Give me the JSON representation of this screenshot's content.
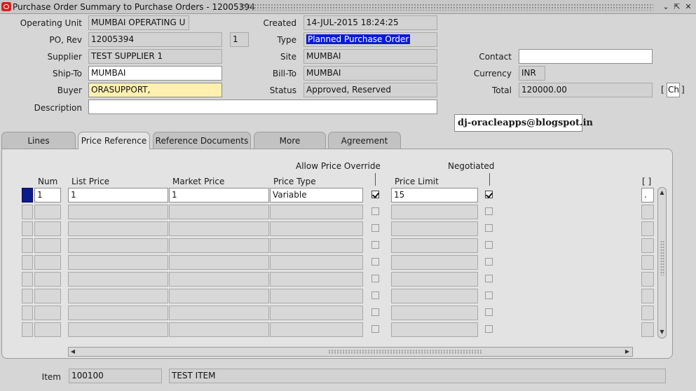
{
  "window": {
    "title": "Purchase Order Summary to Purchase Orders - 12005394",
    "buttons": {
      "minimize": "⌄",
      "restore": "⇱",
      "close": "✕"
    }
  },
  "header": {
    "operating_unit": {
      "label": "Operating Unit",
      "value": "MUMBAI OPERATING U"
    },
    "po_rev": {
      "label": "PO, Rev",
      "po": "12005394",
      "rev": "1"
    },
    "supplier": {
      "label": "Supplier",
      "value": "TEST SUPPLIER 1"
    },
    "ship_to": {
      "label": "Ship-To",
      "value": "MUMBAI"
    },
    "buyer": {
      "label": "Buyer",
      "value": "ORASUPPORT,"
    },
    "description": {
      "label": "Description",
      "value": ""
    },
    "created": {
      "label": "Created",
      "value": "14-JUL-2015 18:24:25"
    },
    "type": {
      "label": "Type",
      "value": "Planned Purchase Order"
    },
    "site": {
      "label": "Site",
      "value": "MUMBAI"
    },
    "bill_to": {
      "label": "Bill-To",
      "value": "MUMBAI"
    },
    "status": {
      "label": "Status",
      "value": "Approved, Reserved"
    },
    "contact": {
      "label": "Contact",
      "value": ""
    },
    "currency": {
      "label": "Currency",
      "value": "INR"
    },
    "total": {
      "label": "Total",
      "value": "120000.00",
      "bracket_left": "[",
      "bracket_right": "]",
      "flex_value": "Ch"
    }
  },
  "watermark": "dj-oracleapps@blogspot.in",
  "tabs": [
    {
      "label": "Lines",
      "active": false
    },
    {
      "label": "Price Reference",
      "active": true
    },
    {
      "label": "Reference Documents",
      "active": false
    },
    {
      "label": "More",
      "active": false
    },
    {
      "label": "Agreement",
      "active": false
    }
  ],
  "table": {
    "headers": {
      "num": "Num",
      "list_price": "List Price",
      "market_price": "Market Price",
      "price_type": "Price Type",
      "allow_override": "Allow Price Override",
      "price_limit": "Price Limit",
      "negotiated": "Negotiated",
      "flex": "[ ]"
    },
    "rows": [
      {
        "num": "1",
        "list_price": "1",
        "market_price": "1",
        "price_type": "Variable",
        "allow_override": true,
        "price_limit": "15",
        "negotiated": true,
        "flex": "."
      },
      {
        "num": "",
        "list_price": "",
        "market_price": "",
        "price_type": "",
        "allow_override": false,
        "price_limit": "",
        "negotiated": false,
        "flex": ""
      },
      {
        "num": "",
        "list_price": "",
        "market_price": "",
        "price_type": "",
        "allow_override": false,
        "price_limit": "",
        "negotiated": false,
        "flex": ""
      },
      {
        "num": "",
        "list_price": "",
        "market_price": "",
        "price_type": "",
        "allow_override": false,
        "price_limit": "",
        "negotiated": false,
        "flex": ""
      },
      {
        "num": "",
        "list_price": "",
        "market_price": "",
        "price_type": "",
        "allow_override": false,
        "price_limit": "",
        "negotiated": false,
        "flex": ""
      },
      {
        "num": "",
        "list_price": "",
        "market_price": "",
        "price_type": "",
        "allow_override": false,
        "price_limit": "",
        "negotiated": false,
        "flex": ""
      },
      {
        "num": "",
        "list_price": "",
        "market_price": "",
        "price_type": "",
        "allow_override": false,
        "price_limit": "",
        "negotiated": false,
        "flex": ""
      },
      {
        "num": "",
        "list_price": "",
        "market_price": "",
        "price_type": "",
        "allow_override": false,
        "price_limit": "",
        "negotiated": false,
        "flex": ""
      },
      {
        "num": "",
        "list_price": "",
        "market_price": "",
        "price_type": "",
        "allow_override": false,
        "price_limit": "",
        "negotiated": false,
        "flex": ""
      }
    ]
  },
  "footer": {
    "item": {
      "label": "Item",
      "code": "100100",
      "description": "TEST ITEM"
    }
  },
  "colors": {
    "selection": "#0a1bd6",
    "record_indicator": "#0c1a8a",
    "logo": "#d81c1c",
    "buyer_field": "#fff0b0"
  }
}
